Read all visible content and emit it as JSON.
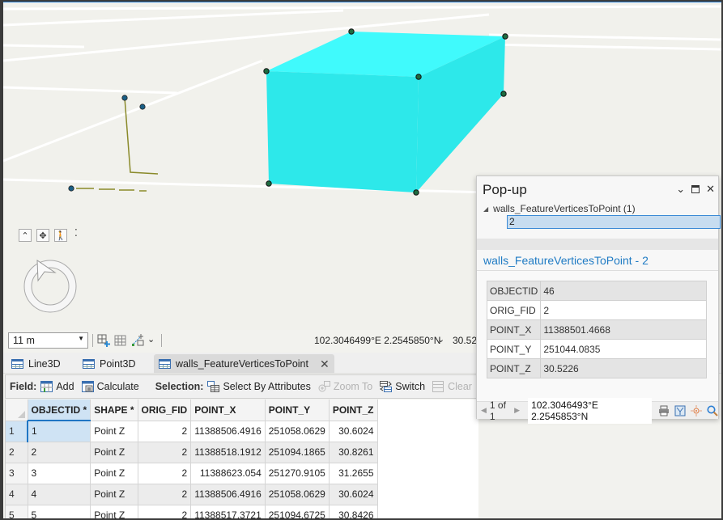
{
  "map": {
    "feature_color": "#2de8ea",
    "feature_top_color": "#40fafc",
    "vertex_color": "#1f6b3f",
    "line_color": "#8a8a2a",
    "point_color": "#1a5f86",
    "nav_controls": [
      "up-chevron-icon",
      "pan-icon",
      "walk-icon",
      "dots-icon"
    ]
  },
  "map_status": {
    "scale": "11 m",
    "coordinates": "102.3046499°E 2.2545850°N",
    "elevation": "30.52"
  },
  "tabs": [
    {
      "label": "Line3D",
      "active": false
    },
    {
      "label": "Point3D",
      "active": false
    },
    {
      "label": "walls_FeatureVerticesToPoint",
      "active": true
    }
  ],
  "toolbar": {
    "field_label": "Field:",
    "add_label": "Add",
    "calculate_label": "Calculate",
    "selection_label": "Selection:",
    "select_by_attributes_label": "Select By Attributes",
    "zoom_to_label": "Zoom To",
    "switch_label": "Switch",
    "clear_label": "Clear"
  },
  "table": {
    "columns": [
      "OBJECTID *",
      "SHAPE *",
      "ORIG_FID",
      "POINT_X",
      "POINT_Y",
      "POINT_Z"
    ],
    "rows": [
      {
        "n": "1",
        "objectid": "1",
        "shape": "Point Z",
        "orig_fid": "2",
        "x": "11388506.4916",
        "y": "251058.0629",
        "z": "30.6024"
      },
      {
        "n": "2",
        "objectid": "2",
        "shape": "Point Z",
        "orig_fid": "2",
        "x": "11388518.1912",
        "y": "251094.1865",
        "z": "30.8261"
      },
      {
        "n": "3",
        "objectid": "3",
        "shape": "Point Z",
        "orig_fid": "2",
        "x": "11388623.054",
        "y": "251270.9105",
        "z": "31.2655"
      },
      {
        "n": "4",
        "objectid": "4",
        "shape": "Point Z",
        "orig_fid": "2",
        "x": "11388506.4916",
        "y": "251058.0629",
        "z": "30.6024"
      },
      {
        "n": "5",
        "objectid": "5",
        "shape": "Point Z",
        "orig_fid": "2",
        "x": "11388517.3721",
        "y": "251094.6725",
        "z": "30.8426"
      }
    ]
  },
  "popup": {
    "title": "Pop-up",
    "layer_node": "walls_FeatureVerticesToPoint (1)",
    "selected_feature": "2",
    "feature_title": "walls_FeatureVerticesToPoint - 2",
    "attributes": [
      {
        "key": "OBJECTID",
        "value": "46"
      },
      {
        "key": "ORIG_FID",
        "value": "2"
      },
      {
        "key": "POINT_X",
        "value": "11388501.4668"
      },
      {
        "key": "POINT_Y",
        "value": "251044.0835"
      },
      {
        "key": "POINT_Z",
        "value": "30.5226"
      }
    ],
    "pager": "1 of 1",
    "coordinates": "102.3046493°E 2.2545853°N"
  }
}
